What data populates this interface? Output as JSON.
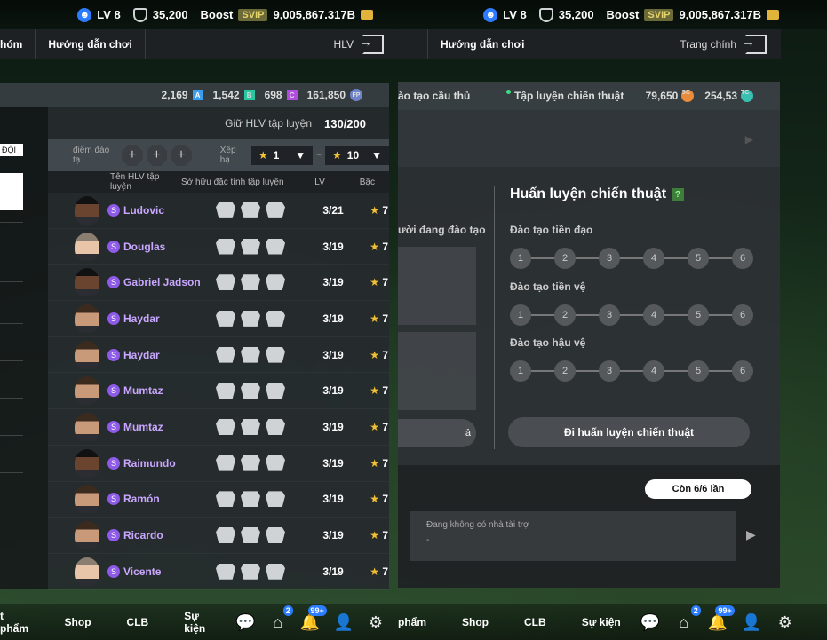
{
  "topbar": {
    "level": "LV 8",
    "shield_value": "35,200",
    "boost_label": "Boost",
    "svip_label": "SVIP",
    "gold": "9,005,867.317B"
  },
  "left": {
    "nav": {
      "partial_tab": "hóm",
      "guide_tab": "Hướng dẫn chơi",
      "right_label": "HLV"
    },
    "resources": {
      "a_value": "2,169",
      "a_label": "A",
      "b_value": "1,542",
      "b_label": "B",
      "c_value": "698",
      "c_label": "C",
      "fp_value": "161,850",
      "fp_label": "FP"
    },
    "strip_label": "ĐỘI",
    "coach_head": {
      "label": "Giữ HLV tập luyện",
      "count": "130/200"
    },
    "filter": {
      "points_label": "điểm đào tạ",
      "sort_label": "Xếp hạ",
      "min_star": "1",
      "dash": "~",
      "max_star": "10"
    },
    "columns": {
      "name": "Tên HLV tập luyện",
      "traits": "Sở hữu đặc tính tập luyện",
      "lv": "LV",
      "grade": "Bậc"
    },
    "coaches": [
      {
        "name": "Ludovic",
        "lv": "3/21",
        "grade": "7"
      },
      {
        "name": "Douglas",
        "lv": "3/19",
        "grade": "7"
      },
      {
        "name": "Gabriel Jadson",
        "lv": "3/19",
        "grade": "7"
      },
      {
        "name": "Haydar",
        "lv": "3/19",
        "grade": "7"
      },
      {
        "name": "Haydar",
        "lv": "3/19",
        "grade": "7"
      },
      {
        "name": "Mumtaz",
        "lv": "3/19",
        "grade": "7"
      },
      {
        "name": "Mumtaz",
        "lv": "3/19",
        "grade": "7"
      },
      {
        "name": "Raimundo",
        "lv": "3/19",
        "grade": "7"
      },
      {
        "name": "Ramón",
        "lv": "3/19",
        "grade": "7"
      },
      {
        "name": "Ricardo",
        "lv": "3/19",
        "grade": "7"
      },
      {
        "name": "Vicente",
        "lv": "3/19",
        "grade": "7"
      }
    ],
    "bottomnav": {
      "item1": "t phẩm",
      "shop": "Shop",
      "clb": "CLB",
      "events": "Sự kiện",
      "badge_home": "2",
      "badge_bell": "99+"
    }
  },
  "right": {
    "nav": {
      "guide_tab": "Hướng dẫn chơi",
      "right_label": "Trang chính"
    },
    "tabs": {
      "tab1": "ào tạo cầu thủ",
      "tab2": "Tập luyện chiến thuật",
      "sc_value": "79,650",
      "sc_label": "SC",
      "tc_value": "254,53",
      "tc_label": "TC"
    },
    "prev_label": "ười đang đào tạo",
    "prev_btn": "ả",
    "tactic": {
      "title": "Huấn luyện chiến thuật",
      "help": "?",
      "tracks": [
        {
          "label": "Đào tạo tiền đạo",
          "steps": [
            "1",
            "2",
            "3",
            "4",
            "5",
            "6"
          ]
        },
        {
          "label": "Đào tạo tiền vệ",
          "steps": [
            "1",
            "2",
            "3",
            "4",
            "5",
            "6"
          ]
        },
        {
          "label": "Đào tạo hậu vệ",
          "steps": [
            "1",
            "2",
            "3",
            "4",
            "5",
            "6"
          ]
        }
      ],
      "train_button": "Đi huấn luyện chiến thuật"
    },
    "remaining": "Còn 6/6 lần",
    "sponsor_text": "Đang không có nhà tài trợ",
    "sponsor_sub": "-",
    "bottomnav": {
      "item1": "phẩm",
      "shop": "Shop",
      "clb": "CLB",
      "events": "Sự kiện",
      "badge_home": "2",
      "badge_bell": "99+"
    }
  }
}
